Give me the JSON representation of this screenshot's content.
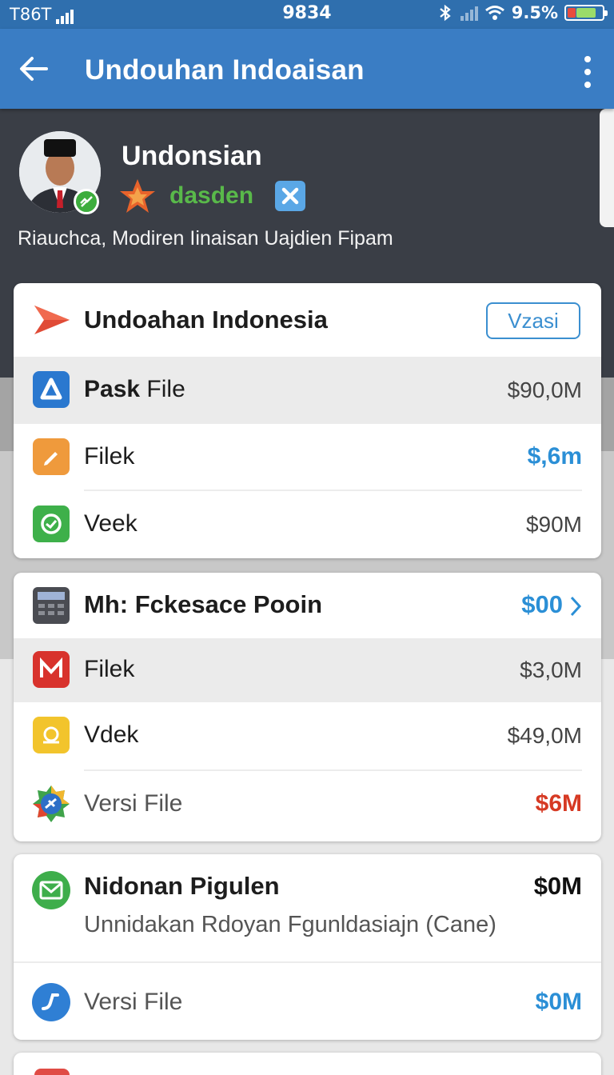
{
  "status_bar": {
    "left_text": "T86T",
    "center_text": "9834",
    "battery_text": "9.5%"
  },
  "app_bar": {
    "title": "Undouhan Indoaisan"
  },
  "profile": {
    "name": "Undonsian",
    "tag": "dasden",
    "description": "Riauchca, Modiren Iinaisan Uajdien Fipam"
  },
  "card1": {
    "header_title": "Undoahan Indonesia",
    "header_button": "Vzasi",
    "rows": [
      {
        "label_bold": "Pask",
        "label_rest": "File",
        "value": "$90,0M"
      },
      {
        "label": "Filek",
        "value": "$,6m"
      },
      {
        "label": "Veek",
        "value": "$90M"
      }
    ]
  },
  "card2": {
    "header_title": "Mh: Fckesace Pooin",
    "header_value": "$00",
    "rows": [
      {
        "label": "Filek",
        "value": "$3,0M"
      },
      {
        "label": "Vdek",
        "value": "$49,0M"
      },
      {
        "label": "Versi File",
        "value": "$6M"
      }
    ]
  },
  "card3": {
    "title": "Nidonan Pigulen",
    "value": "$0M",
    "subtitle": "Unnidakan Rdoyan Fgunldasiajn (Cane)",
    "row_label": "Versi File",
    "row_value": "$0M"
  },
  "colors": {
    "status_bar": "#2f6fae",
    "app_bar": "#3a7dc4",
    "profile_bg": "#3a3e46",
    "accent_blue": "#2b8fd6",
    "accent_red": "#d63a24",
    "tag_green": "#59b94a"
  }
}
